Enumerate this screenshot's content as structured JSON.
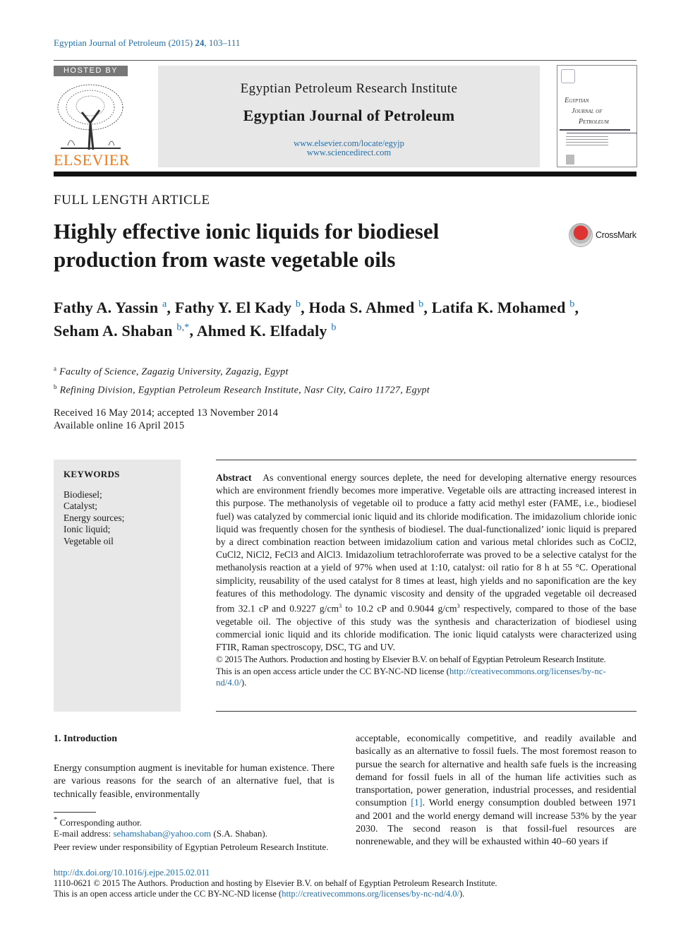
{
  "journal_ref": {
    "name": "Egyptian Journal of Petroleum (2015)",
    "volume": "24",
    "pages": ", 103–111"
  },
  "header": {
    "hosted_by": "HOSTED BY",
    "publisher_logo": "ELSEVIER",
    "institute": "Egyptian Petroleum Research Institute",
    "journal_title": "Egyptian Journal of Petroleum",
    "url1": "www.elsevier.com/locate/egyjp",
    "url2": "www.sciencedirect.com",
    "cover_title": [
      "Egyptian",
      "Journal of",
      "Petroleum"
    ]
  },
  "article_type": "FULL LENGTH ARTICLE",
  "title_lines": [
    "Highly effective ionic liquids for biodiesel",
    "production from waste vegetable oils"
  ],
  "crossmark": "CrossMark",
  "authors": [
    {
      "name": "Fathy A. Yassin",
      "aff": "a"
    },
    {
      "name": "Fathy Y. El Kady",
      "aff": "b"
    },
    {
      "name": "Hoda S. Ahmed",
      "aff": "b"
    },
    {
      "name": "Latifa K. Mohamed",
      "aff": "b"
    },
    {
      "name": "Seham A. Shaban",
      "aff": "b,*"
    },
    {
      "name": "Ahmed K. Elfadaly",
      "aff": "b"
    }
  ],
  "affiliations": [
    {
      "mark": "a",
      "text": "Faculty of Science, Zagazig University, Zagazig, Egypt"
    },
    {
      "mark": "b",
      "text": "Refining Division, Egyptian Petroleum Research Institute, Nasr City, Cairo 11727, Egypt"
    }
  ],
  "dates": {
    "received": "Received 16 May 2014; accepted 13 November 2014",
    "online": "Available online 16 April 2015"
  },
  "keywords": {
    "heading": "KEYWORDS",
    "items": [
      "Biodiesel;",
      "Catalyst;",
      "Energy sources;",
      "Ionic liquid;",
      "Vegetable oil"
    ]
  },
  "abstract": {
    "label": "Abstract",
    "text_a": "As conventional energy sources deplete, the need for developing alternative energy resources which are environment friendly becomes more imperative. Vegetable oils are attracting increased interest in this purpose. The methanolysis of vegetable oil to produce a fatty acid methyl ester (FAME, i.e., biodiesel fuel) was catalyzed by commercial ionic liquid and its chloride modification. The imidazolium chloride ionic liquid was frequently chosen for the synthesis of biodiesel. The dual-functionalized’ ionic liquid is prepared by a direct combination reaction between imidazolium cation and various metal chlorides such as CoCl2, CuCl2, NiCl2, FeCl3 and AlCl3. Imidazolium tetrachloroferrate was proved to be a selective catalyst for the methanolysis reaction at a yield of 97% when used at 1:10, catalyst: oil ratio for 8 h at 55 °C. Operational simplicity, reusability of the used catalyst for 8 times at least, high yields and no saponification are the key features of this methodology. The dynamic viscosity and density of the upgraded vegetable oil decreased from 32.1 cP and 0.9227 g/cm",
    "text_b": " to 10.2 cP and 0.9044 g/cm",
    "text_c": " respectively, compared to those of the base vegetable oil. The objective of this study was the synthesis and characterization of biodiesel using commercial ionic liquid and its chloride modification. The ionic liquid catalysts were characterized using FTIR, Raman spectroscopy, DSC, TG and UV.",
    "sup": "3",
    "copyright": "© 2015 The Authors. Production and hosting by Elsevier B.V. on behalf of Egyptian Petroleum Research Institute.",
    "license_pre": "This is an open access article under the CC BY-NC-ND license (",
    "license_url": "http://creativecommons.org/licenses/by-nc-nd/4.0/",
    "license_post": ")."
  },
  "intro": {
    "heading": "1. Introduction",
    "col1": "Energy consumption augment is inevitable for human existence. There are various reasons for the search of an alternative fuel, that is technically feasible, environmentally",
    "col2_a": "acceptable, economically competitive, and readily available and basically as an alternative to fossil fuels. The most foremost reason to pursue the search for alternative and health safe fuels is the increasing demand for fossil fuels in all of the human life activities such as transportation, power generation, industrial processes, and residential consumption ",
    "col2_ref": "[1]",
    "col2_b": ". World energy consumption doubled between 1971 and 2001 and the world energy demand will increase 53% by the year 2030. The second reason is that fossil-fuel resources are nonrenewable, and they will be exhausted within 40–60 years if"
  },
  "footnote": {
    "star": "*",
    "corr": "Corresponding author.",
    "email_label": "E-mail address: ",
    "email": "sehamshaban@yahoo.com",
    "email_name": " (S.A. Shaban).",
    "peer": "Peer review under responsibility of Egyptian Petroleum Research Institute."
  },
  "footer": {
    "doi": "http://dx.doi.org/10.1016/j.ejpe.2015.02.011",
    "issn_line": "1110-0621 © 2015 The Authors. Production and hosting by Elsevier B.V. on behalf of Egyptian Petroleum Research Institute.",
    "license_pre": "This is an open access article under the CC BY-NC-ND license (",
    "license_url": "http://creativecommons.org/licenses/by-nc-nd/4.0/",
    "license_post": ")."
  }
}
